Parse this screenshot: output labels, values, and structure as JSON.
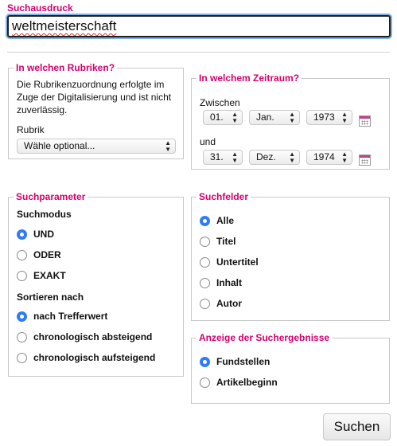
{
  "search": {
    "label": "Suchausdruck",
    "value": "weltmeisterschaft"
  },
  "rubriken": {
    "legend": "In welchen Rubriken?",
    "info_line1": "Die Rubrikenzuordnung erfolgte im",
    "info_line2": "Zuge der Digitalisierung und ist nicht",
    "info_line3": "zuverlässig.",
    "rubrik_label": "Rubrik",
    "rubrik_select": "Wähle optional..."
  },
  "zeitraum": {
    "legend": "In welchem Zeitraum?",
    "from_label": "Zwischen",
    "from_day": "01.",
    "from_month": "Jan.",
    "from_year": "1973",
    "to_label": "und",
    "to_day": "31.",
    "to_month": "Dez.",
    "to_year": "1974"
  },
  "params": {
    "legend": "Suchparameter",
    "mode_heading": "Suchmodus",
    "modes": [
      "UND",
      "ODER",
      "EXAKT"
    ],
    "mode_selected": 0,
    "sort_heading": "Sortieren nach",
    "sorts": [
      "nach Trefferwert",
      "chronologisch absteigend",
      "chronologisch aufsteigend"
    ],
    "sort_selected": 0
  },
  "fields": {
    "legend": "Suchfelder",
    "items": [
      "Alle",
      "Titel",
      "Untertitel",
      "Inhalt",
      "Autor"
    ],
    "selected": 0
  },
  "display": {
    "legend": "Anzeige der Suchergebnisse",
    "items": [
      "Fundstellen",
      "Artikelbeginn"
    ],
    "selected": 0
  },
  "submit_label": "Suchen",
  "colors": {
    "accent": "#d4006e",
    "radio_selected": "#2f7cf6",
    "focus_ring": "#7fb0ea"
  }
}
